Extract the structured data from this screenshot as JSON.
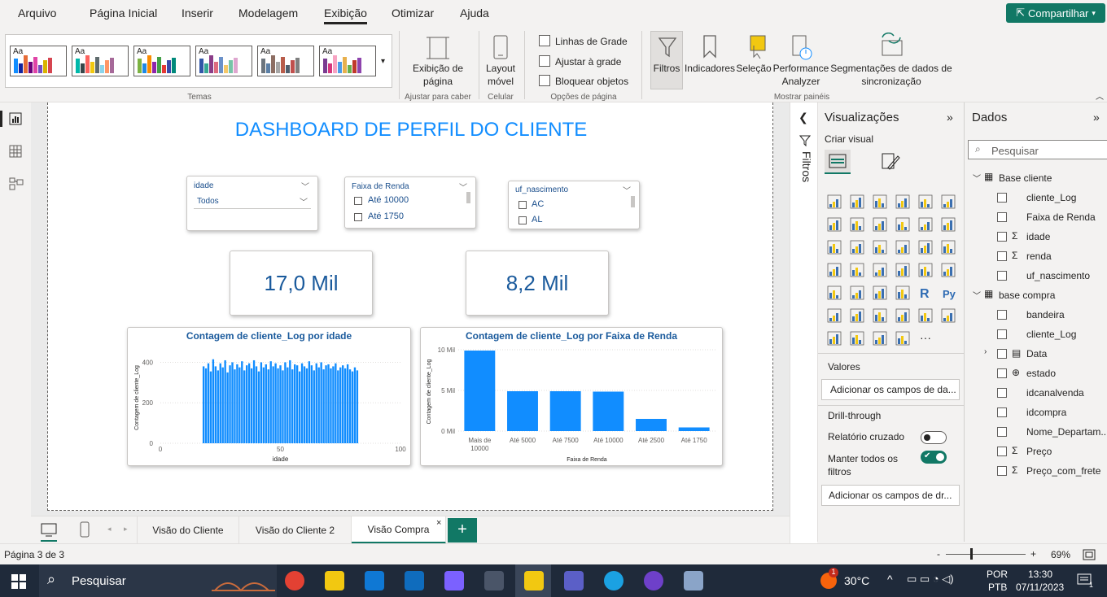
{
  "menu": {
    "tabs": [
      "Arquivo",
      "Página Inicial",
      "Inserir",
      "Modelagem",
      "Exibição",
      "Otimizar",
      "Ajuda"
    ],
    "share_label": "Compartilhar"
  },
  "ribbon": {
    "themes_label": "Temas",
    "theme_aa": "Aa",
    "page_view_label": "Exibição de página",
    "page_view_group": "Ajustar para caber",
    "mobile_layout_label": "Layout móvel",
    "mobile_group": "Celular",
    "options": [
      "Linhas de Grade",
      "Ajustar à grade",
      "Bloquear objetos"
    ],
    "options_group": "Opções de página",
    "panes": [
      "Filtros",
      "Indicadores",
      "Seleção",
      "Performance Analyzer",
      "Segmentações de dados de sincronização"
    ],
    "panes_group": "Mostrar painéis"
  },
  "dashboard": {
    "title": "DASHBOARD DE PERFIL DO CLIENTE",
    "slicer_idade": {
      "title": "idade",
      "value": "Todos"
    },
    "slicer_renda": {
      "title": "Faixa de Renda",
      "items": [
        "Até 10000",
        "Até 1750"
      ]
    },
    "slicer_uf": {
      "title": "uf_nascimento",
      "items": [
        "AC",
        "AL"
      ]
    },
    "kpi1": "17,0 Mil",
    "kpi2": "8,2 Mil"
  },
  "chart_data": [
    {
      "type": "bar",
      "title": "Contagem de cliente_Log por idade",
      "xlabel": "idade",
      "ylabel": "Contagem de cliente_Log",
      "x_ticks": [
        "0",
        "50",
        "100"
      ],
      "y_ticks": [
        "0",
        "200",
        "400"
      ],
      "xlim": [
        0,
        100
      ],
      "ylim": [
        0,
        450
      ],
      "x_start": 18,
      "values": [
        380,
        370,
        395,
        355,
        415,
        380,
        360,
        395,
        375,
        410,
        350,
        385,
        400,
        365,
        390,
        375,
        405,
        360,
        385,
        395,
        370,
        410,
        380,
        355,
        400,
        375,
        390,
        365,
        405,
        380,
        395,
        370,
        385,
        360,
        400,
        375,
        410,
        365,
        390,
        385,
        355,
        395,
        380,
        370,
        405,
        385,
        360,
        395,
        375,
        400,
        365,
        385,
        390,
        370,
        380,
        395,
        360,
        375,
        385,
        370,
        390,
        365,
        355,
        375,
        360
      ]
    },
    {
      "type": "bar",
      "title": "Contagem de cliente_Log por Faixa de Renda",
      "xlabel": "Faixa de Renda",
      "ylabel": "Contagem de cliente_Log",
      "y_ticks": [
        "0 Mil",
        "5 Mil",
        "10 Mil"
      ],
      "ylim": [
        0,
        10500
      ],
      "categories": [
        "Mais de 10000",
        "Até 5000",
        "Até 7500",
        "Até 10000",
        "Até 2500",
        "Até 1750"
      ],
      "values": [
        9900,
        4900,
        4900,
        4850,
        1500,
        450
      ]
    }
  ],
  "filters_pane": {
    "label": "Filtros"
  },
  "viz_pane": {
    "title": "Visualizações",
    "build_visual": "Criar visual",
    "values_label": "Valores",
    "values_placeholder": "Adicionar os campos de da...",
    "drill_label": "Drill-through",
    "cross_report": "Relatório cruzado",
    "keep_filters": "Manter todos os filtros",
    "drill_placeholder": "Adicionar os campos de dr..."
  },
  "data_pane": {
    "title": "Dados",
    "search_placeholder": "Pesquisar",
    "tables": [
      {
        "name": "Base cliente",
        "fields": [
          {
            "name": "cliente_Log",
            "sigma": false
          },
          {
            "name": "Faixa de Renda",
            "sigma": false
          },
          {
            "name": "idade",
            "sigma": true
          },
          {
            "name": "renda",
            "sigma": true
          },
          {
            "name": "uf_nascimento",
            "sigma": false
          }
        ]
      },
      {
        "name": "base compra",
        "fields": [
          {
            "name": "bandeira",
            "sigma": false
          },
          {
            "name": "cliente_Log",
            "sigma": false
          },
          {
            "name": "Data",
            "sigma": false
          },
          {
            "name": "estado",
            "sigma": false
          },
          {
            "name": "idcanalvenda",
            "sigma": false
          },
          {
            "name": "idcompra",
            "sigma": false
          },
          {
            "name": "Nome_Departam...",
            "sigma": false
          },
          {
            "name": "Preço",
            "sigma": true
          },
          {
            "name": "Preço_com_frete",
            "sigma": true
          }
        ]
      }
    ]
  },
  "page_tabs": [
    "Visão do Cliente",
    "Visão do Cliente 2",
    "Visão Compra"
  ],
  "status": {
    "page": "Página 3 de 3",
    "zoom": "69%"
  },
  "taskbar": {
    "search": "Pesquisar",
    "temp": "30°C",
    "lang1": "POR",
    "lang2": "PTB",
    "time": "13:30",
    "date": "07/11/2023",
    "notif": "1"
  },
  "colors": {
    "accent": "#117865",
    "bar": "#118dff",
    "title": "#118dff"
  }
}
